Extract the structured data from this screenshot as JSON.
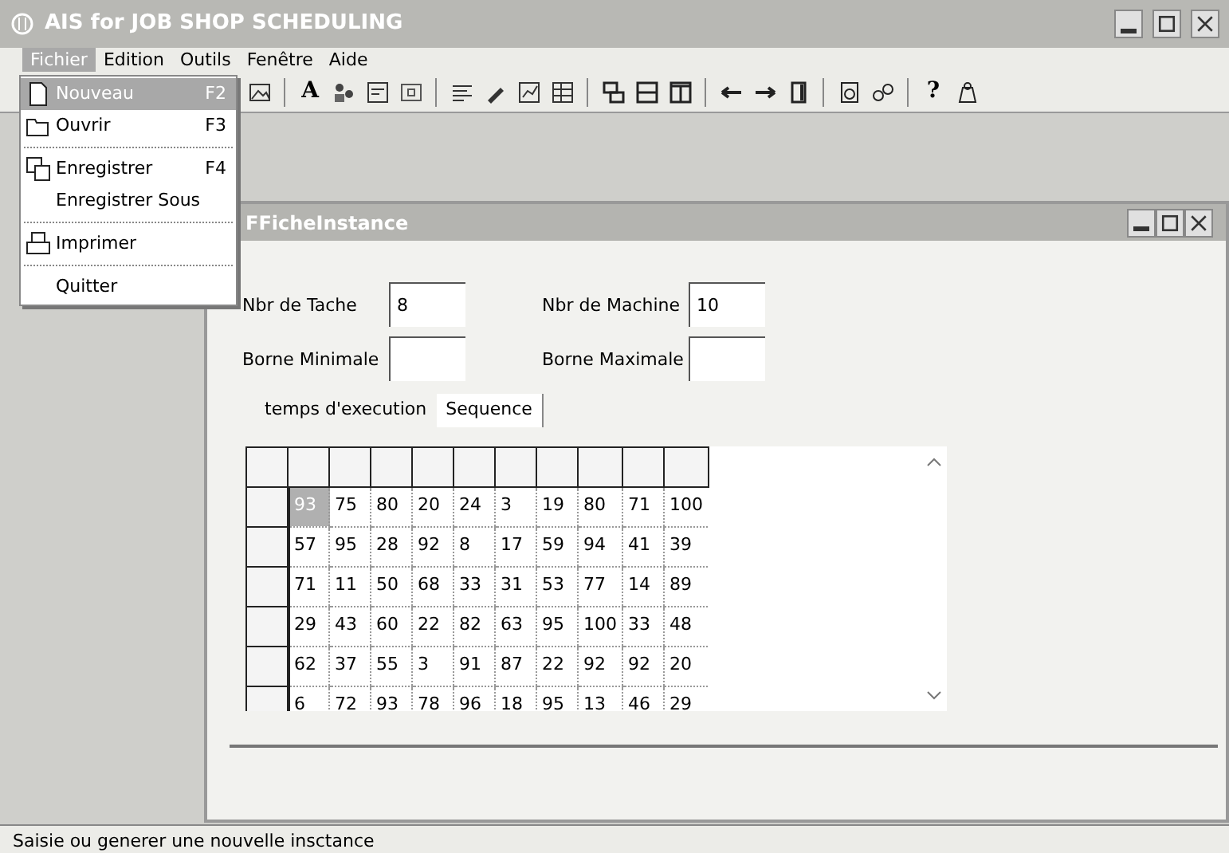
{
  "window": {
    "title": "AIS for JOB SHOP SCHEDULING"
  },
  "menu_bar": [
    {
      "label": "Fichier",
      "selected": true
    },
    {
      "label": "Edition",
      "selected": false
    },
    {
      "label": "Outils",
      "selected": false
    },
    {
      "label": "Fenêtre",
      "selected": false
    },
    {
      "label": "Aide",
      "selected": false
    }
  ],
  "dropdown": [
    {
      "kind": "item",
      "label": "Nouveau",
      "shortcut": "F2",
      "selected": true
    },
    {
      "kind": "item",
      "label": "Ouvrir",
      "shortcut": "F3",
      "selected": false
    },
    {
      "kind": "separator"
    },
    {
      "kind": "item",
      "label": "Enregistrer",
      "shortcut": "F4",
      "selected": false
    },
    {
      "kind": "item",
      "label": "Enregistrer Sous",
      "selected": false
    },
    {
      "kind": "separator"
    },
    {
      "kind": "item",
      "label": "Imprimer",
      "selected": false
    },
    {
      "kind": "separator"
    },
    {
      "kind": "item",
      "label": "Quitter",
      "selected": false
    }
  ],
  "toolbar": [
    {
      "kind": "icon"
    },
    {
      "kind": "sep"
    },
    {
      "kind": "text",
      "text": "A"
    },
    {
      "kind": "icon"
    },
    {
      "kind": "icon"
    },
    {
      "kind": "icon"
    },
    {
      "kind": "sep"
    },
    {
      "kind": "icon"
    },
    {
      "kind": "icon"
    },
    {
      "kind": "icon"
    },
    {
      "kind": "icon"
    },
    {
      "kind": "sep"
    },
    {
      "kind": "icon"
    },
    {
      "kind": "icon"
    },
    {
      "kind": "icon"
    },
    {
      "kind": "sep"
    },
    {
      "kind": "icon"
    },
    {
      "kind": "icon"
    },
    {
      "kind": "icon"
    },
    {
      "kind": "sep"
    },
    {
      "kind": "icon"
    },
    {
      "kind": "icon"
    },
    {
      "kind": "sep"
    },
    {
      "kind": "text",
      "text": "?"
    },
    {
      "kind": "icon"
    }
  ],
  "child_window": {
    "title": "FFicheInstance",
    "fields": [
      {
        "label": "Nbr de Tache",
        "value": "8"
      },
      {
        "label": "Nbr de Machine",
        "value": "10"
      },
      {
        "label": "Borne Minimale"
      },
      {
        "label": "Borne Maximale"
      }
    ],
    "tabs": [
      {
        "label": "temps d'execution",
        "selected": false
      },
      {
        "label": "Sequence",
        "selected": true
      }
    ],
    "grid": {
      "rows": [
        {
          "cells": [
            "93",
            "75",
            "80",
            "20",
            "24",
            "3",
            "19",
            "80",
            "71",
            "100"
          ],
          "selected": [
            true,
            false,
            false,
            false,
            false,
            false,
            false,
            false,
            false,
            false
          ]
        },
        {
          "cells": [
            "57",
            "95",
            "28",
            "92",
            "8",
            "17",
            "59",
            "94",
            "41",
            "39"
          ]
        },
        {
          "cells": [
            "71",
            "11",
            "50",
            "68",
            "33",
            "31",
            "53",
            "77",
            "14",
            "89"
          ]
        },
        {
          "cells": [
            "29",
            "43",
            "60",
            "22",
            "82",
            "63",
            "95",
            "100",
            "33",
            "48"
          ]
        },
        {
          "cells": [
            "62",
            "37",
            "55",
            "3",
            "91",
            "87",
            "22",
            "92",
            "92",
            "20"
          ]
        },
        {
          "cells": [
            "6",
            "72",
            "93",
            "78",
            "96",
            "18",
            "95",
            "13",
            "46",
            "29"
          ]
        }
      ]
    }
  },
  "status_bar": "Saisie ou generer une nouvelle insctance"
}
